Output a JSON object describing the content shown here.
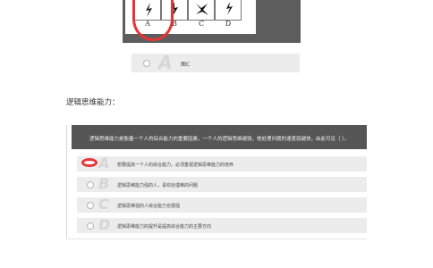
{
  "figure_question": {
    "option_labels": [
      "A",
      "B",
      "C",
      "D"
    ],
    "option_c": {
      "letter": "A",
      "text": "图C"
    }
  },
  "section_title": "逻辑思维能力：",
  "question2": {
    "stem": "逻辑思维能力是衡量一个人的综合能力的重要因素，一个人的逻辑思维越强，他处理问题的速度就越快，由此可见（ ）。",
    "options": [
      {
        "letter": "A",
        "text": "想要提高一个人的综合能力，必须重视逻辑思维能力的培养",
        "selected": true
      },
      {
        "letter": "B",
        "text": "逻辑思维能力强的人，喜欢处理难的问题",
        "selected": false
      },
      {
        "letter": "C",
        "text": "逻辑思维强的人综合能力也很强",
        "selected": false
      },
      {
        "letter": "D",
        "text": "逻辑思维能力的提升是提高综合能力的主要方向",
        "selected": false
      }
    ]
  },
  "colors": {
    "header_bg": "#565656",
    "option_bg": "#ececec",
    "annotation_red": "#e53535"
  }
}
